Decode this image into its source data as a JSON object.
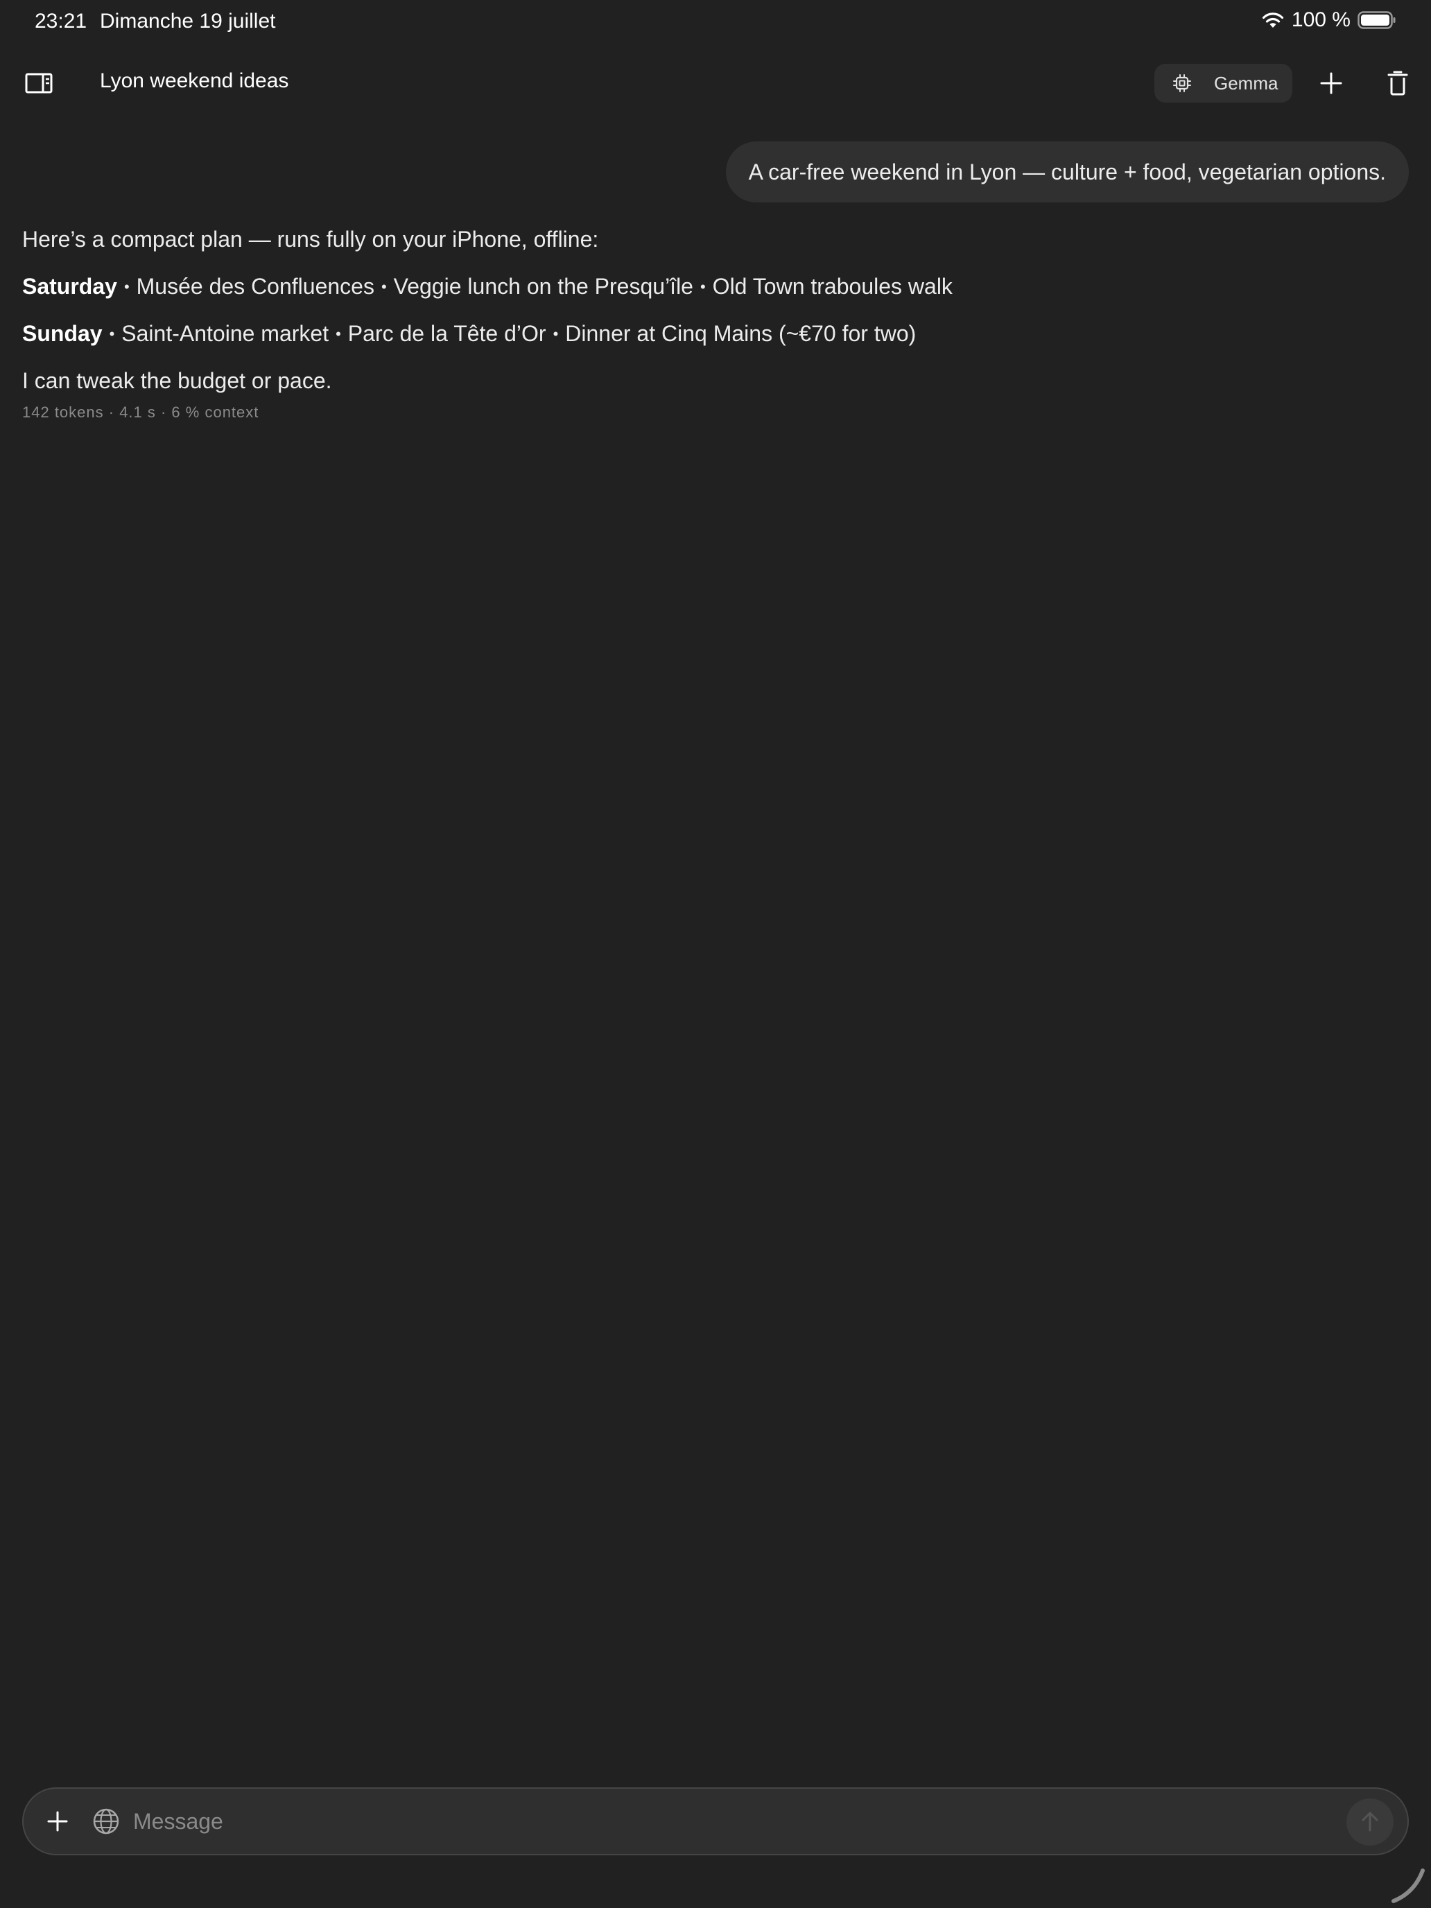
{
  "status_bar": {
    "time": "23:21",
    "date": "Dimanche 19 juillet",
    "battery": "100 %"
  },
  "header": {
    "title": "Lyon weekend ideas",
    "model_name": "Gemma"
  },
  "conversation": {
    "user_message": "A car-free weekend in Lyon — culture + food, vegetarian options.",
    "assistant": {
      "intro": "Here’s a compact plan — runs fully on your iPhone, offline:",
      "days": [
        {
          "label": "Saturday",
          "items": [
            "Musée des Confluences",
            "Veggie lunch on the Presqu’île",
            "Old Town traboules walk"
          ]
        },
        {
          "label": "Sunday",
          "items": [
            "Saint-Antoine market",
            "Parc de la Tête d’Or",
            "Dinner at Cinq Mains (~€70 for two)"
          ]
        }
      ],
      "closing": "I can tweak the budget or pace.",
      "meta": "142 tokens · 4.1 s · 6 % context"
    }
  },
  "composer": {
    "placeholder": "Message"
  },
  "colors": {
    "background": "#212121",
    "bubble": "#303030",
    "muted_text": "#8b8b8b"
  }
}
